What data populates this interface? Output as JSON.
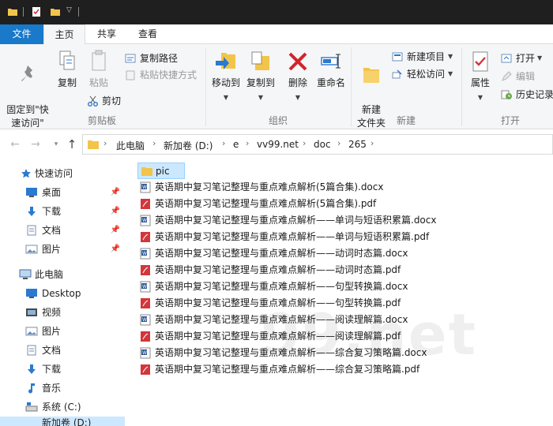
{
  "ribbon_tabs": {
    "file": "文件",
    "home": "主页",
    "share": "共享",
    "view": "查看"
  },
  "ribbon": {
    "clipboard": {
      "pin_quick_access": "固定到\"快\n速访问\"",
      "copy": "复制",
      "paste": "粘贴",
      "copy_path": "复制路径",
      "paste_shortcut": "粘贴快捷方式",
      "cut": "剪切",
      "group_label": "剪贴板"
    },
    "organize": {
      "move_to": "移动到",
      "copy_to": "复制到",
      "delete": "删除",
      "rename": "重命名",
      "group_label": "组织"
    },
    "new": {
      "new_folder": "新建\n文件夹",
      "new_item": "新建项目",
      "easy_access": "轻松访问",
      "group_label": "新建"
    },
    "open": {
      "properties": "属性",
      "open": "打开",
      "edit": "编辑",
      "history": "历史记录",
      "group_label": "打开"
    }
  },
  "address_bar": {
    "crumbs": [
      "此电脑",
      "新加卷 (D:)",
      "e",
      "vv99.net",
      "doc",
      "265"
    ]
  },
  "nav_pane": {
    "quick_access": "快速访问",
    "desktop": "桌面",
    "downloads": "下载",
    "documents": "文档",
    "pictures": "图片",
    "this_pc": "此电脑",
    "pc_desktop": "Desktop",
    "videos": "视频",
    "pc_pictures": "图片",
    "pc_documents": "文档",
    "pc_downloads": "下载",
    "music": "音乐",
    "system_c": "系统 (C:)",
    "new_volume_d": "新加卷 (D:)"
  },
  "files": [
    {
      "name": "pic",
      "type": "folder"
    },
    {
      "name": "英语期中复习笔记整理与重点难点解析(5篇合集).docx",
      "type": "docx"
    },
    {
      "name": "英语期中复习笔记整理与重点难点解析(5篇合集).pdf",
      "type": "pdf"
    },
    {
      "name": "英语期中复习笔记整理与重点难点解析——单词与短语积累篇.docx",
      "type": "docx"
    },
    {
      "name": "英语期中复习笔记整理与重点难点解析——单词与短语积累篇.pdf",
      "type": "pdf"
    },
    {
      "name": "英语期中复习笔记整理与重点难点解析——动词时态篇.docx",
      "type": "docx"
    },
    {
      "name": "英语期中复习笔记整理与重点难点解析——动词时态篇.pdf",
      "type": "pdf"
    },
    {
      "name": "英语期中复习笔记整理与重点难点解析——句型转换篇.docx",
      "type": "docx"
    },
    {
      "name": "英语期中复习笔记整理与重点难点解析——句型转换篇.pdf",
      "type": "pdf"
    },
    {
      "name": "英语期中复习笔记整理与重点难点解析——阅读理解篇.docx",
      "type": "docx"
    },
    {
      "name": "英语期中复习笔记整理与重点难点解析——阅读理解篇.pdf",
      "type": "pdf"
    },
    {
      "name": "英语期中复习笔记整理与重点难点解析——综合复习策略篇.docx",
      "type": "docx"
    },
    {
      "name": "英语期中复习笔记整理与重点难点解析——综合复习策略篇.pdf",
      "type": "pdf"
    }
  ],
  "watermark": "99.net",
  "colors": {
    "accent": "#1979ca",
    "selection": "#cce8ff",
    "folder": "#f3c44a",
    "word": "#2b5797",
    "pdf": "#d3363a"
  }
}
